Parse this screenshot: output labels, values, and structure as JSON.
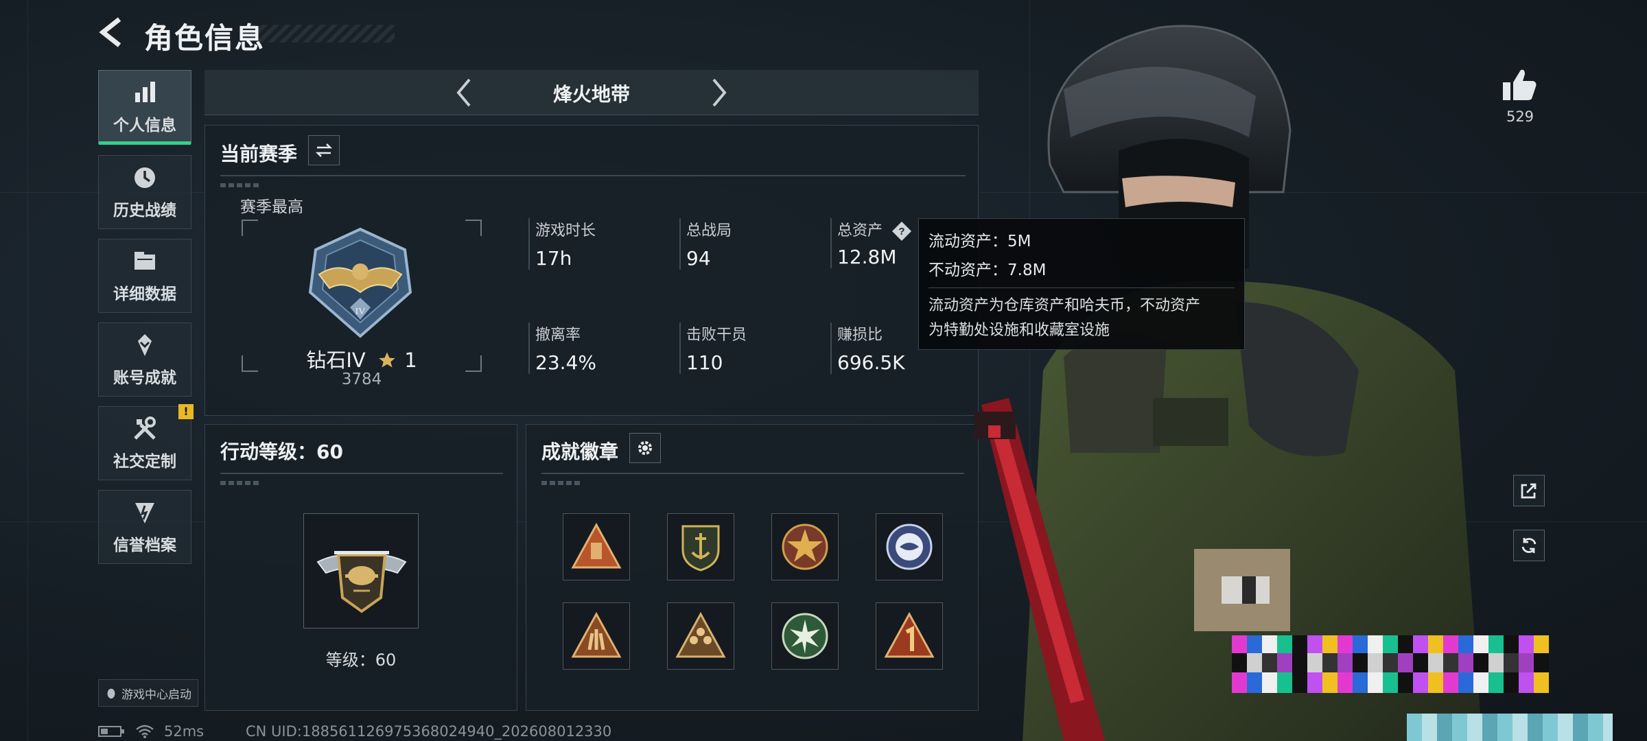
{
  "header": {
    "title": "角色信息"
  },
  "sidebar": {
    "items": [
      {
        "label": "个人信息",
        "icon": "bar-chart-icon",
        "active": true
      },
      {
        "label": "历史战绩",
        "icon": "clock-icon",
        "active": false
      },
      {
        "label": "详细数据",
        "icon": "folder-icon",
        "active": false
      },
      {
        "label": "账号成就",
        "icon": "achievement-icon",
        "active": false
      },
      {
        "label": "社交定制",
        "icon": "tools-icon",
        "active": false,
        "alert": "!"
      },
      {
        "label": "信誉档案",
        "icon": "shield-emblem-icon",
        "active": false
      }
    ],
    "game_center": "游戏中心启动"
  },
  "mode": {
    "title": "烽火地带"
  },
  "season": {
    "title": "当前赛季",
    "best_label": "赛季最高",
    "rank_name": "钻石IV",
    "rank_stars": "1",
    "rank_score": "3784",
    "stats": [
      {
        "label": "游戏时长",
        "value": "17h"
      },
      {
        "label": "总战局",
        "value": "94"
      },
      {
        "label": "总资产",
        "value": "12.8M"
      },
      {
        "label": "撤离率",
        "value": "23.4%"
      },
      {
        "label": "击败干员",
        "value": "110"
      },
      {
        "label": "赚损比",
        "value": "696.5K"
      }
    ]
  },
  "tooltip": {
    "liquid": "流动资产：5M",
    "fixed": "不动资产：7.8M",
    "desc_line1": "流动资产为仓库资产和哈夫币，不动资产",
    "desc_line2": "为特勤处设施和收藏室设施"
  },
  "level": {
    "title": "行动等级：60",
    "caption": "等级：60"
  },
  "badges": {
    "title": "成就徽章",
    "items": [
      "badge-1",
      "badge-2",
      "badge-3",
      "badge-4",
      "badge-5",
      "badge-6",
      "badge-7",
      "badge-8"
    ]
  },
  "like": {
    "count": "529"
  },
  "footer": {
    "ping": "52ms",
    "uid": "CN UID:1885611269753680249​40_202608012330"
  },
  "colors": {
    "accent": "#33d08a",
    "alert": "#e9b823",
    "panel": "#182027"
  }
}
